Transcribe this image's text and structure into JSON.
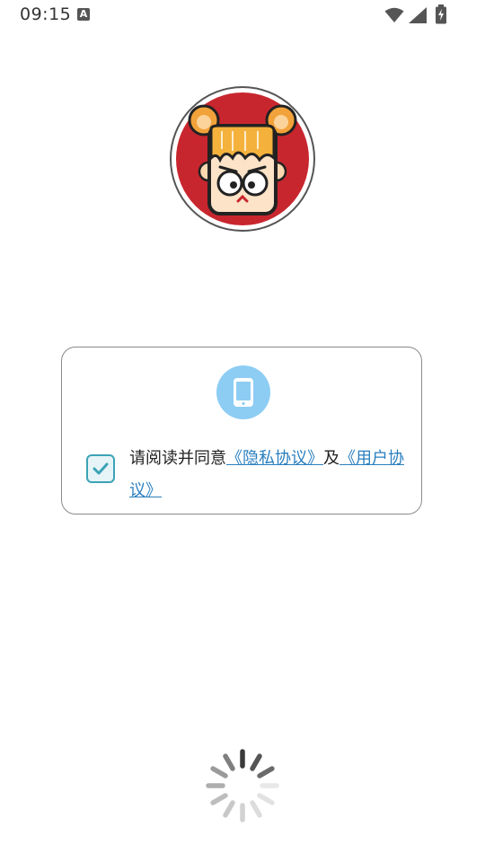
{
  "status_bar": {
    "time": "09:15",
    "notification_glyph": "A",
    "icons": [
      "wifi-icon",
      "signal-icon",
      "battery-charging-icon"
    ]
  },
  "logo": {
    "icon": "cartoon-character-logo"
  },
  "consent": {
    "icon": "phone-icon",
    "checked": true,
    "text_prefix": "请阅读并同意",
    "privacy_link": "《隐私协议》",
    "conjunction": "及",
    "user_link": "《用户协议》"
  },
  "loading": {
    "icon": "loading-spinner-icon"
  },
  "colors": {
    "link": "#2a7fbf",
    "checkbox": "#3ba3b6",
    "badge": "#8dcdf4",
    "logo_red": "#c8262e"
  }
}
